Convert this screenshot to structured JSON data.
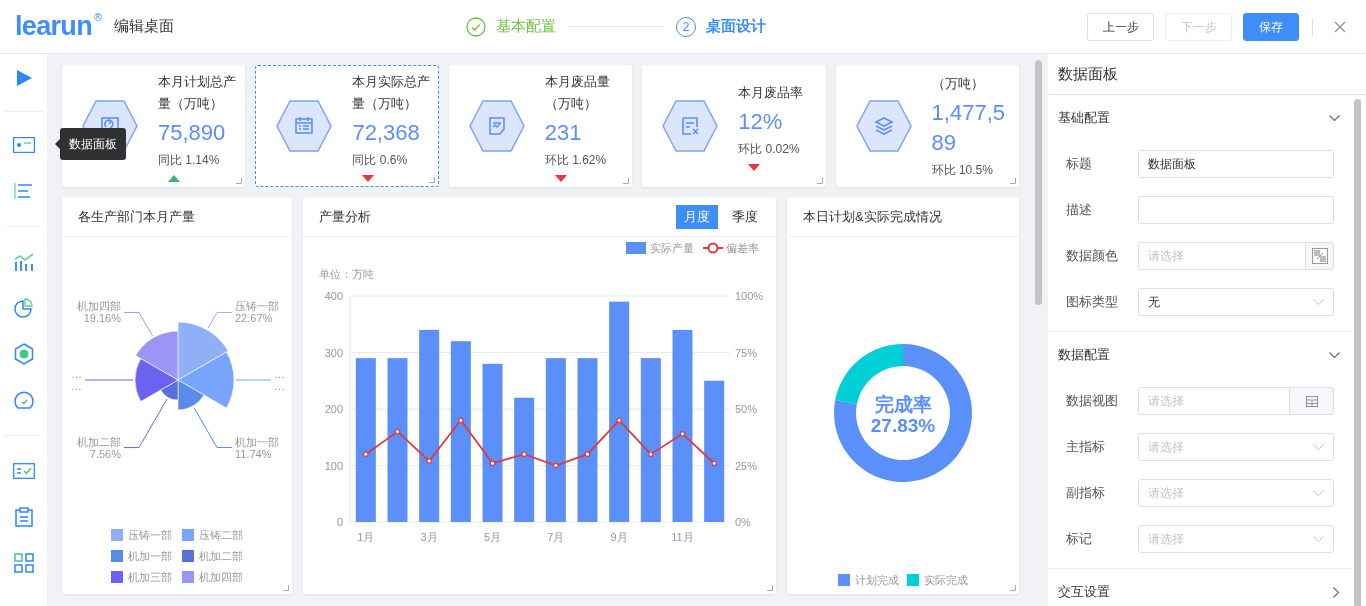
{
  "header": {
    "logo": "learun",
    "logo_mark": "®",
    "title": "编辑桌面",
    "steps": [
      {
        "label": "基本配置",
        "done": true,
        "active": false
      },
      {
        "number": "2",
        "label": "桌面设计",
        "done": false,
        "active": true
      }
    ],
    "buttons": [
      {
        "label": "上一步",
        "kind": "default",
        "disabled": false
      },
      {
        "label": "下一步",
        "kind": "default",
        "disabled": true
      },
      {
        "label": "保存",
        "kind": "primary",
        "disabled": false
      }
    ]
  },
  "sidebar": {
    "tooltip": "数据面板"
  },
  "kpi_cards": [
    {
      "kind": "up",
      "title": "本月计划总产量（万吨）",
      "value": "75,890",
      "compare": "同比 1.14%",
      "selected": false
    },
    {
      "kind": "down",
      "title": "本月实际总产量（万吨）",
      "value": "72,368",
      "compare": "同比 0.6%",
      "selected": true
    },
    {
      "kind": "down",
      "title": "本月废品量（万吨）",
      "value": "231",
      "compare": "环比 1.62%",
      "selected": false
    },
    {
      "kind": "down",
      "title": "本月废品率",
      "value": "12%",
      "compare": "环比 0.02%",
      "selected": false
    },
    {
      "kind": "flat",
      "title": "（万吨）",
      "value": "1,477,589",
      "compare": "环比 10.5%",
      "selected": false
    }
  ],
  "dept_output": {
    "title": "各生产部门本月产量",
    "rose": {
      "slices": [
        {
          "name": "压铸一部",
          "color": "#8fb0f7",
          "label": "压铸一部",
          "value_label": "22.67%"
        },
        {
          "name": "压铸二部",
          "color": "#78a5fb",
          "label": "…",
          "value_label": "…"
        },
        {
          "name": "机加一部",
          "color": "#5a8be6",
          "label": "机加一部",
          "value_label": "11.74%"
        },
        {
          "name": "机加二部",
          "color": "#5b6fdc",
          "label": "机加二部",
          "value_label": "7.56%"
        },
        {
          "name": "机加三部",
          "color": "#6a63f2",
          "label": "…",
          "value_label": "…"
        },
        {
          "name": "机加四部",
          "color": "#9b95f5",
          "label": "机加四部",
          "value_label": "19.16%"
        }
      ]
    }
  },
  "output_analysis": {
    "title": "产量分析",
    "tabs": [
      {
        "label": "月度",
        "selected": true
      },
      {
        "label": "季度",
        "selected": false
      }
    ],
    "unit": "单位：万吨",
    "chart_data": {
      "type": "bar",
      "x": [
        1,
        2,
        3,
        4,
        5,
        6,
        7,
        8,
        9,
        10,
        11,
        12
      ],
      "xlim": [
        0.5,
        12.5
      ],
      "xticks": [
        {
          "value": 1,
          "label": "1月"
        },
        {
          "value": 3,
          "label": "3月"
        },
        {
          "value": 5,
          "label": "5月"
        },
        {
          "value": 7,
          "label": "7月"
        },
        {
          "value": 9,
          "label": "9月"
        },
        {
          "value": 11,
          "label": "11月"
        }
      ],
      "series": [
        {
          "name": "实际产量",
          "type": "bar",
          "color": "#5b8ff9",
          "values": [
            290,
            290,
            340,
            320,
            280,
            220,
            290,
            290,
            390,
            290,
            340,
            250
          ]
        },
        {
          "name": "偏差率",
          "type": "line",
          "axis": "y2",
          "marker": "circle",
          "color": "#e0393e",
          "values": [
            30,
            40,
            27,
            45,
            26,
            30,
            25,
            30,
            45,
            30,
            39,
            26
          ]
        }
      ],
      "ylim": [
        0,
        400
      ],
      "yticks": [
        0,
        100,
        200,
        300,
        400
      ],
      "grid": true,
      "legend": "top-right",
      "y2lim": [
        0,
        100
      ],
      "y2ticks": [
        {
          "value": 0,
          "label": "0%"
        },
        {
          "value": 25,
          "label": "25%"
        },
        {
          "value": 50,
          "label": "50%"
        },
        {
          "value": 75,
          "label": "75%"
        },
        {
          "value": 100,
          "label": "100%"
        }
      ]
    }
  },
  "daily_completion": {
    "title": "本日计划&实际完成情况",
    "chart_data": {
      "type": "donut",
      "categories": [
        "计划完成",
        "实际完成"
      ],
      "series": [
        {
          "colors": [
            "#5b8ff9",
            "#00d0d6"
          ],
          "values": [
            78,
            22
          ]
        }
      ],
      "annotations": [
        "完成率",
        "27.83%"
      ]
    }
  },
  "panel": {
    "title": "数据面板",
    "sections": [
      {
        "title": "基础配置",
        "expanded": true,
        "fields": [
          {
            "label": "标题",
            "kind": "text",
            "value": "数据面板"
          },
          {
            "label": "描述",
            "kind": "text"
          },
          {
            "label": "数据颜色",
            "kind": "color",
            "placeholder": "请选择"
          },
          {
            "label": "图标类型",
            "kind": "select",
            "value": "无"
          }
        ]
      },
      {
        "title": "数据配置",
        "expanded": true,
        "fields": [
          {
            "label": "数据视图",
            "kind": "view",
            "placeholder": "请选择"
          },
          {
            "label": "主指标",
            "kind": "select",
            "placeholder": "请选择"
          },
          {
            "label": "副指标",
            "kind": "select",
            "placeholder": "请选择"
          },
          {
            "label": "标记",
            "kind": "select",
            "placeholder": "请选择"
          }
        ]
      },
      {
        "title": "交互设置",
        "expanded": false
      }
    ]
  }
}
